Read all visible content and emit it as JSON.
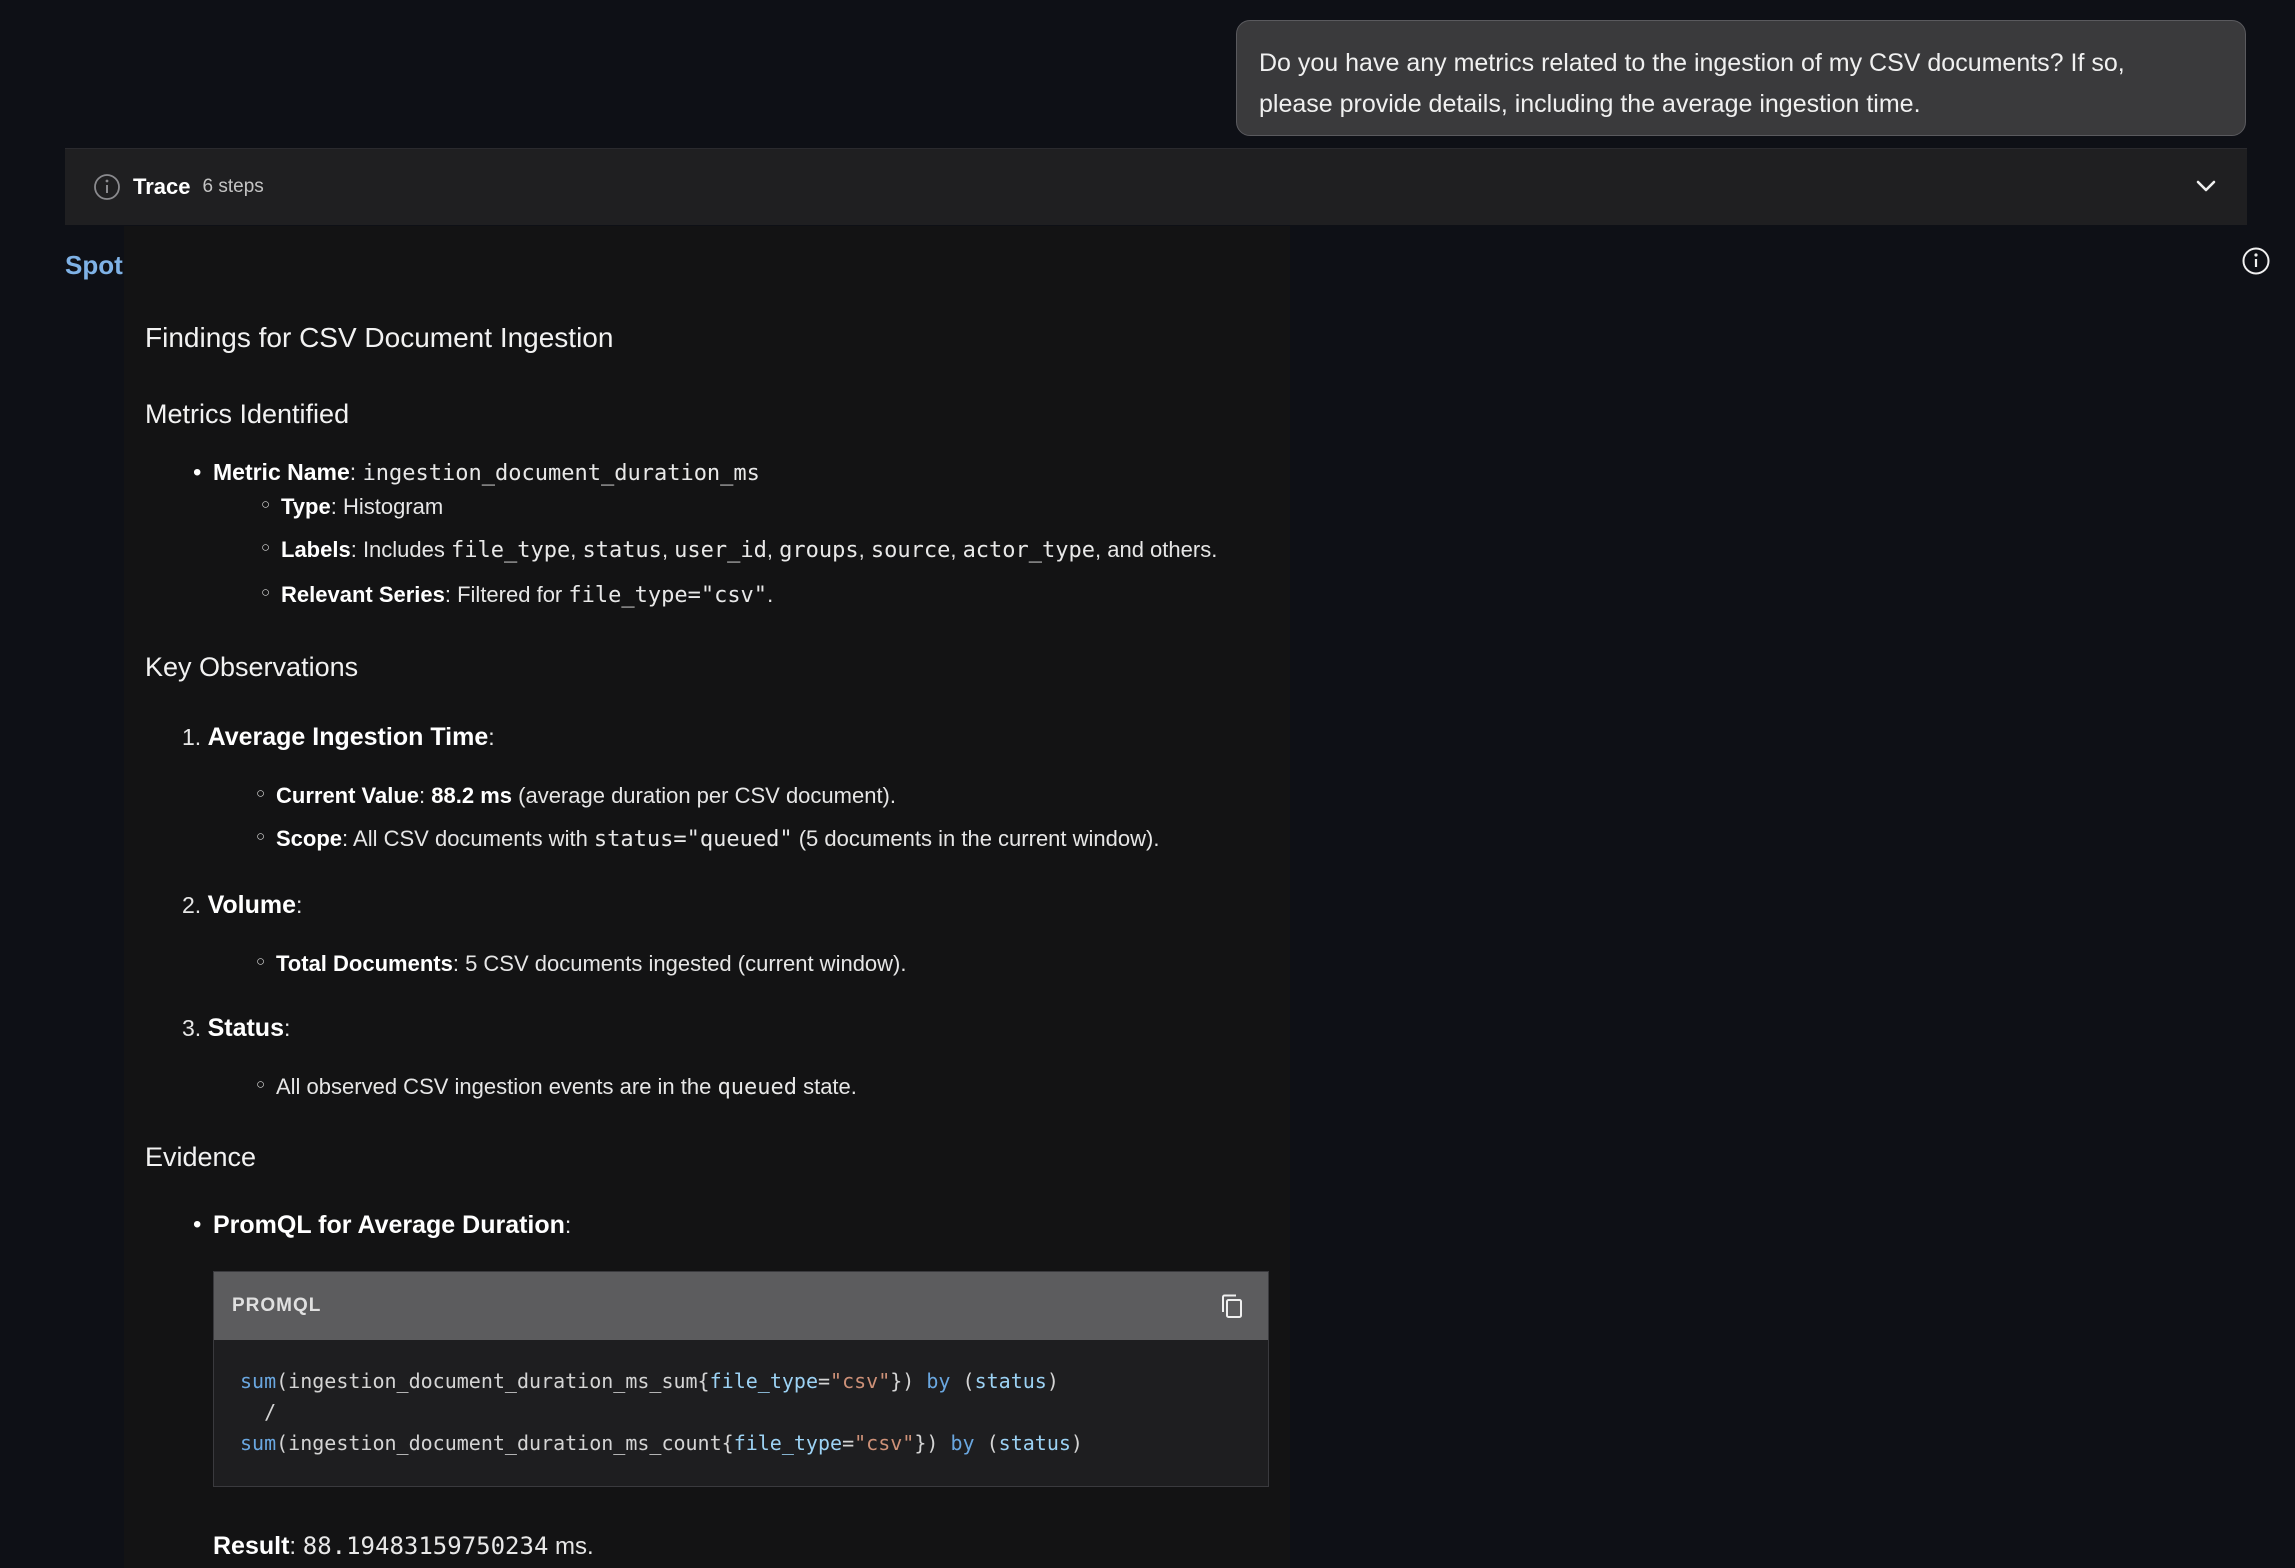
{
  "user_message": {
    "line1": "Do you have any metrics related to the ingestion of my CSV documents? If so,",
    "line2": "please provide details, including the average ingestion time."
  },
  "trace": {
    "title": "Trace",
    "steps": "6 steps"
  },
  "assistant_name": "Spot",
  "heading": "Findings for CSV Document Ingestion",
  "metrics": {
    "heading": "Metrics Identified",
    "metric_name_label": "Metric Name",
    "metric_name_value": "ingestion_document_duration_ms",
    "type_label": "Type",
    "type_value": "Histogram",
    "labels_label": "Labels",
    "labels_prefix": "Includes ",
    "labels_list": [
      "file_type",
      "status",
      "user_id",
      "groups",
      "source",
      "actor_type"
    ],
    "labels_suffix": ", and others.",
    "series_label": "Relevant Series",
    "series_prefix": "Filtered for ",
    "series_value": "file_type=\"csv\"",
    "series_suffix": "."
  },
  "observations": {
    "heading": "Key Observations",
    "items": [
      {
        "num": "1.",
        "title": "Average Ingestion Time",
        "subs": [
          {
            "label": "Current Value",
            "strong": "88.2 ms",
            "text": " (average duration per CSV document)."
          },
          {
            "label": "Scope",
            "text_before": "All CSV documents with ",
            "code": "status=\"queued\"",
            "text_after": " (5 documents in the current window)."
          }
        ]
      },
      {
        "num": "2.",
        "title": "Volume",
        "subs": [
          {
            "label": "Total Documents",
            "text": "5 CSV documents ingested (current window)."
          }
        ]
      },
      {
        "num": "3.",
        "title": "Status",
        "subs": [
          {
            "text_before": "All observed CSV ingestion events are in the ",
            "code": "queued",
            "text_after": " state."
          }
        ]
      }
    ]
  },
  "evidence": {
    "heading": "Evidence",
    "bullet_label": "PromQL for Average Duration",
    "code_lang": "PROMQL",
    "code": {
      "line1_fn": "sum",
      "line1_metric": "(ingestion_document_duration_ms_sum{",
      "line1_label": "file_type",
      "line1_eq": "=",
      "line1_str": "\"csv\"",
      "line1_close": "})",
      "line1_by": "by",
      "line1_group": "status",
      "line2": "/",
      "line3_fn": "sum",
      "line3_metric": "(ingestion_document_duration_ms_count{",
      "line3_label": "file_type",
      "line3_eq": "=",
      "line3_str": "\"csv\"",
      "line3_close": "})",
      "line3_by": "by",
      "line3_group": "status"
    },
    "result_label": "Result",
    "result_value": "88.19483159750234",
    "result_unit": " ms."
  }
}
